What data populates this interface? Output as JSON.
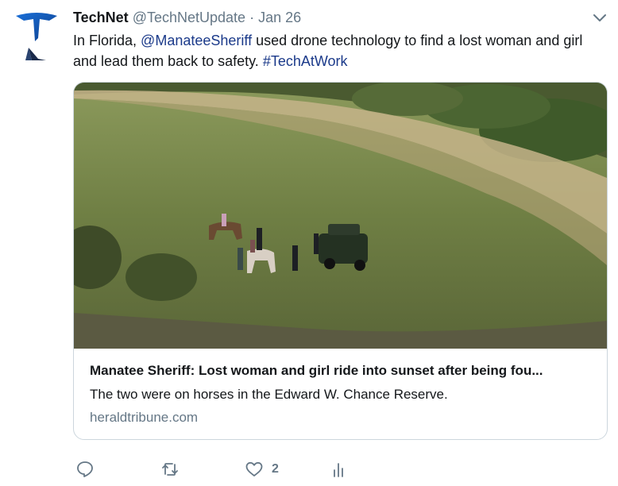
{
  "tweet": {
    "author_name": "TechNet",
    "author_handle": "@TechNetUpdate",
    "separator": "·",
    "date": "Jan 26",
    "text_before": "In Florida, ",
    "mention": "@ManateeSheriff",
    "text_middle": " used drone technology to find a lost woman and girl and lead them back to safety. ",
    "hashtag": "#TechAtWork"
  },
  "card": {
    "title": "Manatee Sheriff: Lost woman and girl ride into sunset after being fou...",
    "description": "The two were on horses in the Edward W. Chance Reserve.",
    "domain": "heraldtribune.com"
  },
  "actions": {
    "reply_icon": "reply-icon",
    "retweet_icon": "retweet-icon",
    "like_icon": "heart-icon",
    "like_count": "2",
    "analytics_icon": "analytics-icon"
  },
  "colors": {
    "link": "#1b3a8a",
    "secondary_text": "#657786",
    "avatar_blue": "#1d6fd6",
    "avatar_navy": "#1a2a4a"
  }
}
